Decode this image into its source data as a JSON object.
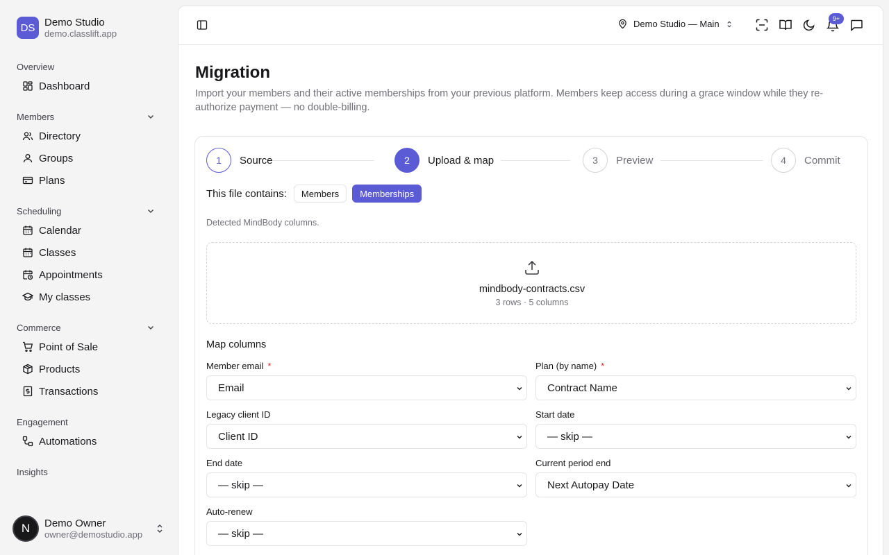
{
  "brand": {
    "initials": "DS",
    "name": "Demo Studio",
    "domain": "demo.classlift.app"
  },
  "nav": {
    "overview": {
      "label": "Overview",
      "items": [
        {
          "label": "Dashboard",
          "icon": "dashboard-icon"
        }
      ]
    },
    "members": {
      "label": "Members",
      "items": [
        {
          "label": "Directory",
          "icon": "users-icon"
        },
        {
          "label": "Groups",
          "icon": "group-icon"
        },
        {
          "label": "Plans",
          "icon": "card-icon"
        }
      ]
    },
    "scheduling": {
      "label": "Scheduling",
      "items": [
        {
          "label": "Calendar",
          "icon": "calendar-icon"
        },
        {
          "label": "Classes",
          "icon": "calendar-icon"
        },
        {
          "label": "Appointments",
          "icon": "calendar-clock-icon"
        },
        {
          "label": "My classes",
          "icon": "graduation-cap-icon"
        }
      ]
    },
    "commerce": {
      "label": "Commerce",
      "items": [
        {
          "label": "Point of Sale",
          "icon": "cart-icon"
        },
        {
          "label": "Products",
          "icon": "package-icon"
        },
        {
          "label": "Transactions",
          "icon": "receipt-icon"
        }
      ]
    },
    "engagement": {
      "label": "Engagement",
      "items": [
        {
          "label": "Automations",
          "icon": "workflow-icon"
        }
      ]
    },
    "insights": {
      "label": "Insights"
    }
  },
  "user": {
    "initial": "N",
    "name": "Demo Owner",
    "email": "owner@demostudio.app"
  },
  "topbar": {
    "location": "Demo Studio — Main",
    "notifications_badge": "9+"
  },
  "page": {
    "title": "Migration",
    "description": "Import your members and their active memberships from your previous platform. Members keep access during a grace window while they re-authorize payment — no double-billing."
  },
  "steps": [
    {
      "number": "1",
      "label": "Source",
      "state": "done"
    },
    {
      "number": "2",
      "label": "Upload & map",
      "state": "active"
    },
    {
      "number": "3",
      "label": "Preview",
      "state": "pending"
    },
    {
      "number": "4",
      "label": "Commit",
      "state": "pending"
    }
  ],
  "file_contains": {
    "label": "This file contains:",
    "options": [
      "Members",
      "Memberships"
    ],
    "selected": "Memberships"
  },
  "detected": "Detected MindBody columns.",
  "upload": {
    "file_name": "mindbody-contracts.csv",
    "meta": "3 rows · 5 columns"
  },
  "mapping": {
    "title": "Map columns",
    "fields": [
      {
        "label": "Member email",
        "required": true,
        "value": "Email"
      },
      {
        "label": "Plan (by name)",
        "required": true,
        "value": "Contract Name"
      },
      {
        "label": "Legacy client ID",
        "required": false,
        "value": "Client ID"
      },
      {
        "label": "Start date",
        "required": false,
        "value": "— skip —"
      },
      {
        "label": "End date",
        "required": false,
        "value": "— skip —"
      },
      {
        "label": "Current period end",
        "required": false,
        "value": "Next Autopay Date"
      },
      {
        "label": "Auto-renew",
        "required": false,
        "value": "— skip —"
      }
    ]
  },
  "colors": {
    "accent": "#5b5bd6",
    "required": "#dc2626",
    "muted": "#71717a"
  }
}
